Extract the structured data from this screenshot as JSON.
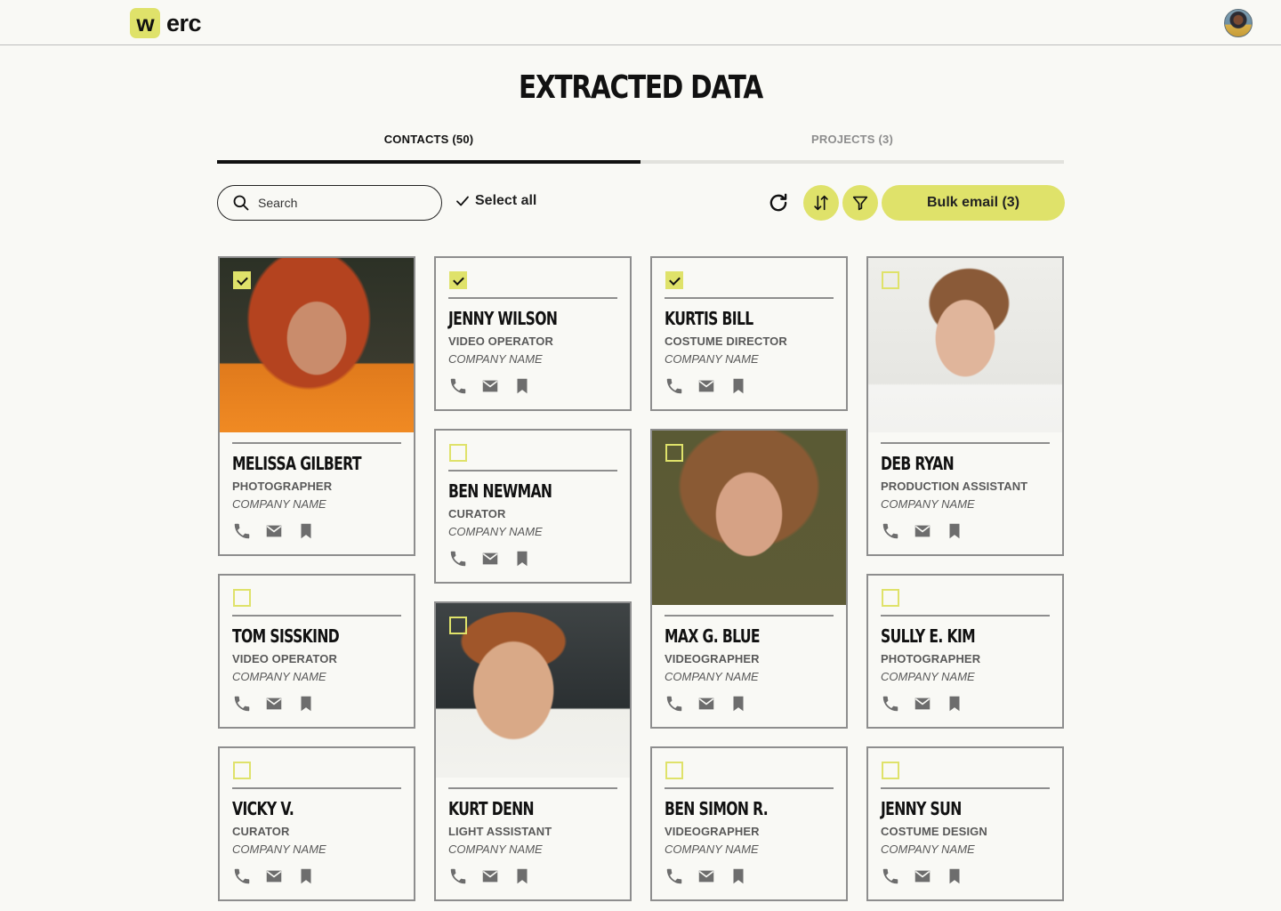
{
  "header": {
    "logo_mark": "w",
    "logo_text": "erc"
  },
  "page_title": "EXTRACTED DATA",
  "tabs": [
    {
      "label": "CONTACTS (50)",
      "active": true
    },
    {
      "label": "PROJECTS (3)",
      "active": false
    }
  ],
  "toolbar": {
    "search_placeholder": "Search",
    "select_all_label": "Select all",
    "bulk_email_label": "Bulk email (3)"
  },
  "colors": {
    "accent": "#dfe26a",
    "border": "#8e8e8e",
    "background": "#f9f9f5"
  },
  "contact_icons": [
    "phone-icon",
    "mail-icon",
    "bookmark-icon"
  ],
  "contacts": [
    {
      "name": "MELISSA GILBERT",
      "role": "PHOTOGRAPHER",
      "company": "COMPANY NAME",
      "checked": true,
      "has_photo": true
    },
    {
      "name": "JENNY WILSON",
      "role": "VIDEO OPERATOR",
      "company": "COMPANY NAME",
      "checked": true,
      "has_photo": false
    },
    {
      "name": "KURTIS BILL",
      "role": "COSTUME DIRECTOR",
      "company": "COMPANY NAME",
      "checked": true,
      "has_photo": false
    },
    {
      "name": "DEB RYAN",
      "role": "PRODUCTION ASSISTANT",
      "company": "COMPANY NAME",
      "checked": false,
      "has_photo": true
    },
    {
      "name": "BEN NEWMAN",
      "role": "CURATOR",
      "company": "COMPANY NAME",
      "checked": false,
      "has_photo": false
    },
    {
      "name": "MAX G. BLUE",
      "role": "VIDEOGRAPHER",
      "company": "COMPANY NAME",
      "checked": false,
      "has_photo": true
    },
    {
      "name": "TOM SISSKIND",
      "role": "VIDEO OPERATOR",
      "company": "COMPANY NAME",
      "checked": false,
      "has_photo": false
    },
    {
      "name": "SULLY E. KIM",
      "role": "PHOTOGRAPHER",
      "company": "COMPANY NAME",
      "checked": false,
      "has_photo": false
    },
    {
      "name": "KURT DENN",
      "role": "LIGHT ASSISTANT",
      "company": "COMPANY NAME",
      "checked": false,
      "has_photo": true
    },
    {
      "name": "VICKY V.",
      "role": "CURATOR",
      "company": "COMPANY NAME",
      "checked": false,
      "has_photo": false
    },
    {
      "name": "BEN SIMON R.",
      "role": "VIDEOGRAPHER",
      "company": "COMPANY NAME",
      "checked": false,
      "has_photo": false
    },
    {
      "name": "JENNY SUN",
      "role": "COSTUME DESIGN",
      "company": "COMPANY NAME",
      "checked": false,
      "has_photo": false
    }
  ]
}
